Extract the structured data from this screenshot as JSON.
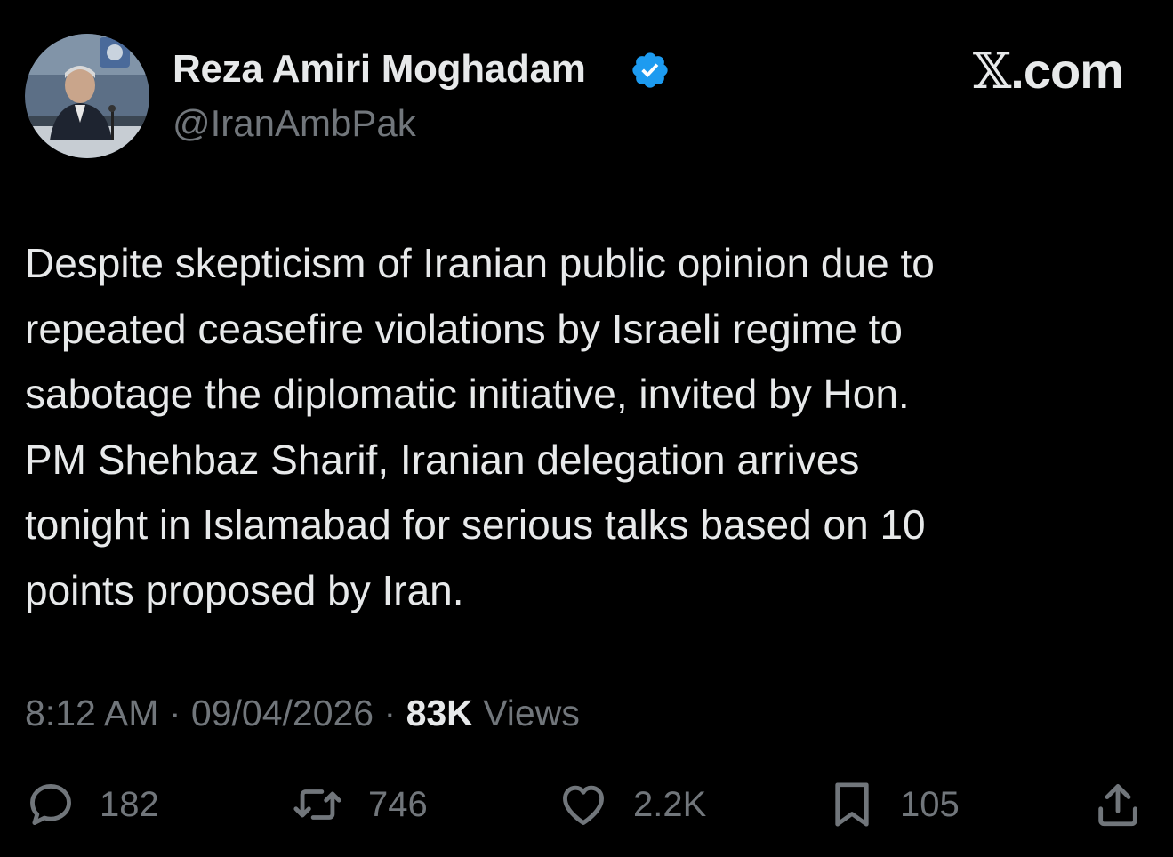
{
  "author": {
    "display_name": "Reza Amiri Moghadam",
    "handle": "@IranAmbPak",
    "verified_icon": "verified-badge-icon",
    "avatar_icon": "profile-photo"
  },
  "brand": {
    "name": "com",
    "logo_icon": "x-logo-icon"
  },
  "tweet": {
    "lines": [
      "Despite skepticism of Iranian public opinion due to",
      "repeated ceasefire violations by Israeli regime to",
      "sabotage the diplomatic initiative, invited by Hon.",
      "PM Shehbaz Sharif, Iranian delegation arrives",
      "tonight in Islamabad for serious talks based on 10",
      "points proposed by Iran."
    ]
  },
  "meta": {
    "time": "8:12 AM",
    "separator": "·",
    "date": "09/04/2026",
    "views_count": "83K",
    "views_label": "Views"
  },
  "actions": {
    "reply": {
      "count": "182",
      "icon": "reply-icon"
    },
    "retweet": {
      "count": "746",
      "icon": "retweet-icon"
    },
    "like": {
      "count": "2.2K",
      "icon": "heart-icon"
    },
    "bookmark": {
      "count": "105",
      "icon": "bookmark-icon"
    },
    "share": {
      "icon": "share-icon"
    }
  },
  "colors": {
    "background": "#000000",
    "primary_text": "#e7e9ea",
    "secondary_text": "#71767b",
    "verified_blue": "#1d9bf0"
  }
}
